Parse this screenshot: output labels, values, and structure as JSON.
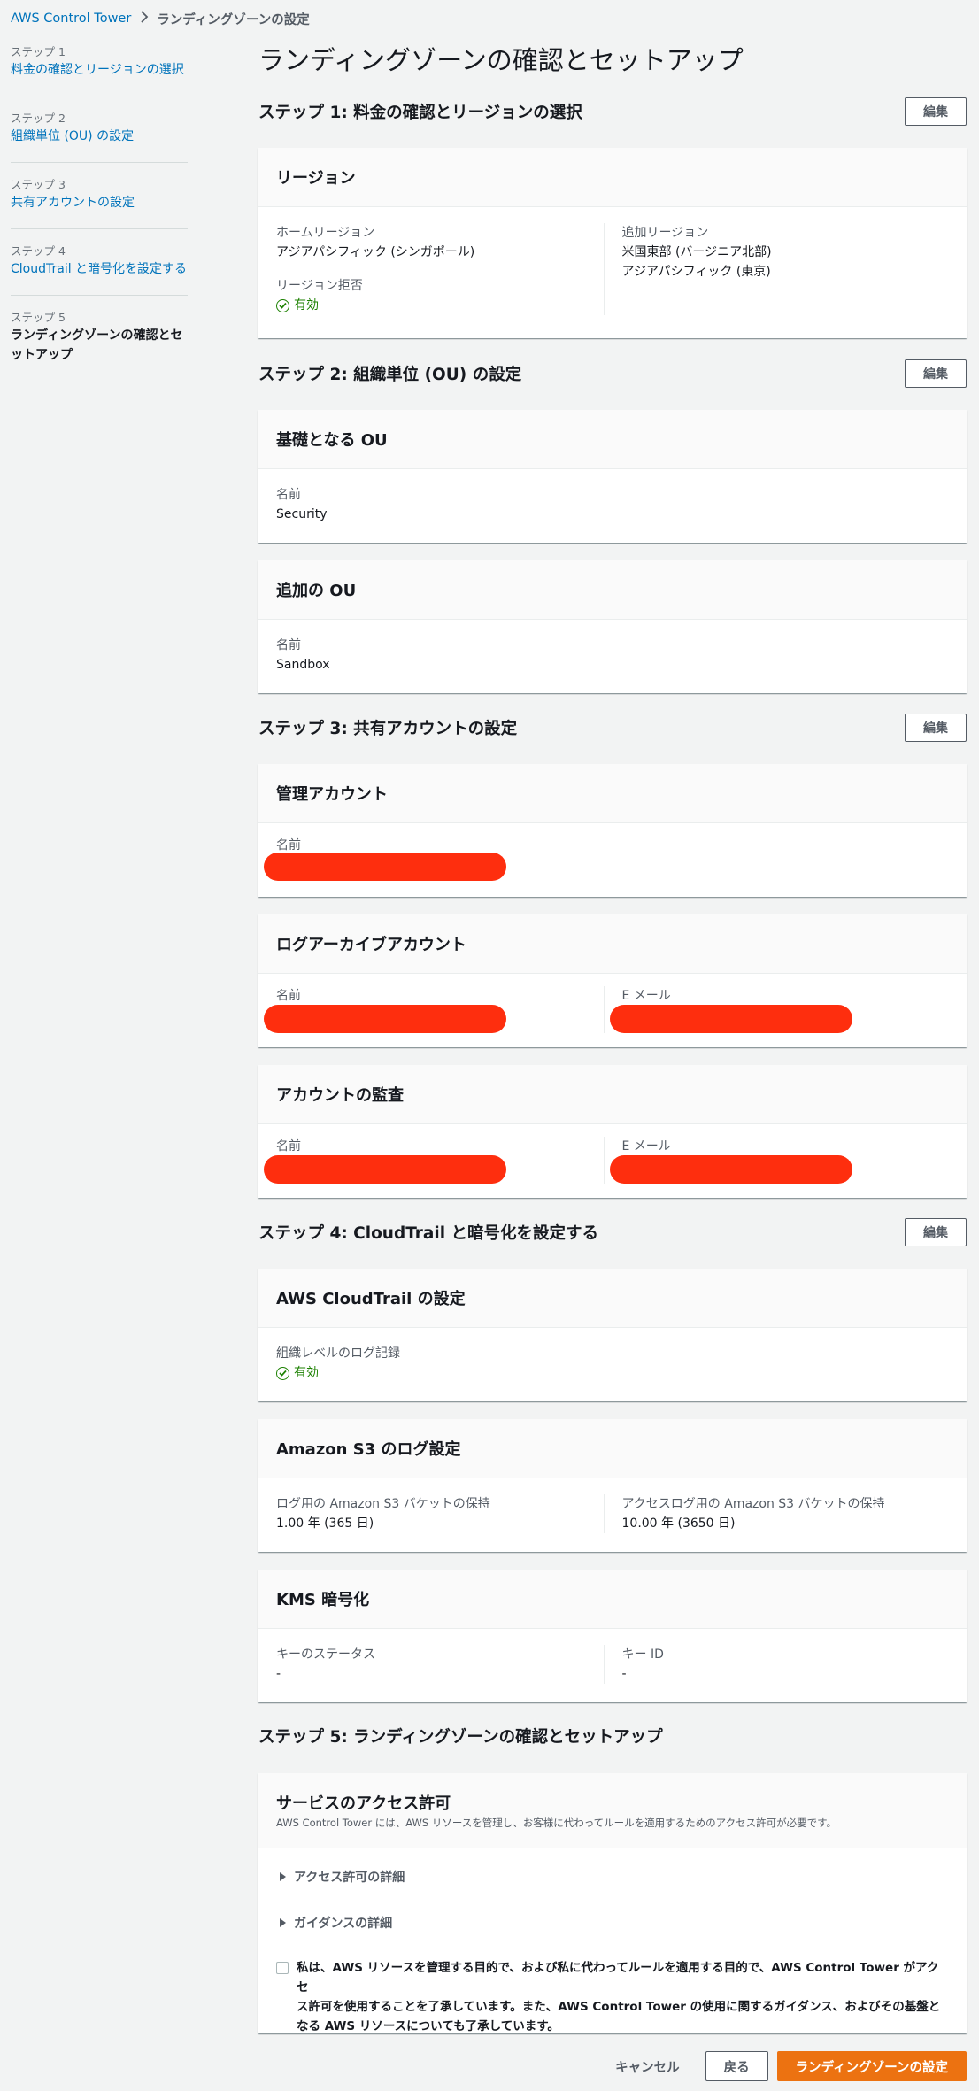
{
  "breadcrumb": {
    "root": "AWS Control Tower",
    "current": "ランディングゾーンの設定"
  },
  "sidenav": [
    {
      "num": "ステップ 1",
      "label": "料金の確認とリージョンの選択"
    },
    {
      "num": "ステップ 2",
      "label": "組織単位 (OU) の設定"
    },
    {
      "num": "ステップ 3",
      "label": "共有アカウントの設定"
    },
    {
      "num": "ステップ 4",
      "label": "CloudTrail と暗号化を設定する"
    },
    {
      "num": "ステップ 5",
      "label_line1": "ランディングゾーンの確認とセ",
      "label_line2": "ットアップ"
    }
  ],
  "page_title": "ランディングゾーンの確認とセットアップ",
  "edit_label": "編集",
  "step1": {
    "title": "ステップ 1: 料金の確認とリージョンの選択",
    "region_panel": {
      "heading": "リージョン",
      "home_region_label": "ホームリージョン",
      "home_region_value": "アジアパシフィック (シンガポール)",
      "deny_label": "リージョン拒否",
      "deny_value": "有効",
      "additional_label": "追加リージョン",
      "additional_values": [
        "米国東部 (バージニア北部)",
        "アジアパシフィック (東京)"
      ]
    }
  },
  "step2": {
    "title": "ステップ 2: 組織単位 (OU) の設定",
    "foundational": {
      "heading": "基礎となる OU",
      "name_label": "名前",
      "name_value": "Security"
    },
    "additional": {
      "heading": "追加の OU",
      "name_label": "名前",
      "name_value": "Sandbox"
    }
  },
  "step3": {
    "title": "ステップ 3: 共有アカウントの設定",
    "management": {
      "heading": "管理アカウント",
      "name_label": "名前"
    },
    "log_archive": {
      "heading": "ログアーカイブアカウント",
      "name_label": "名前",
      "email_label": "E メール"
    },
    "audit": {
      "heading": "アカウントの監査",
      "name_label": "名前",
      "email_label": "E メール"
    }
  },
  "step4": {
    "title": "ステップ 4: CloudTrail と暗号化を設定する",
    "cloudtrail": {
      "heading": "AWS CloudTrail の設定",
      "org_logging_label": "組織レベルのログ記録",
      "org_logging_value": "有効"
    },
    "s3": {
      "heading": "Amazon S3 のログ設定",
      "log_retention_label": "ログ用の Amazon S3 バケットの保持",
      "log_retention_value": "1.00 年 (365 日)",
      "access_retention_label": "アクセスログ用の Amazon S3 バケットの保持",
      "access_retention_value": "10.00 年 (3650 日)"
    },
    "kms": {
      "heading": "KMS 暗号化",
      "key_status_label": "キーのステータス",
      "key_status_value": "-",
      "key_id_label": "キー ID",
      "key_id_value": "-"
    }
  },
  "step5": {
    "title": "ステップ 5: ランディングゾーンの確認とセットアップ",
    "permissions": {
      "heading": "サービスのアクセス許可",
      "subtitle": "AWS Control Tower には、AWS リソースを管理し、お客様に代わってルールを適用するためのアクセス許可が必要です。",
      "expander1": "アクセス許可の詳細",
      "expander2": "ガイダンスの詳細",
      "ack_line1": "私は、AWS リソースを管理する目的で、および私に代わってルールを適用する目的で、AWS Control Tower がアクセ",
      "ack_line2": "ス許可を使用することを了承しています。また、AWS Control Tower の使用に関するガイダンス、およびその基盤と",
      "ack_line3": "なる AWS リソースについても了承しています。"
    }
  },
  "footer": {
    "cancel": "キャンセル",
    "back": "戻る",
    "submit": "ランディングゾーンの設定"
  },
  "colors": {
    "link": "#0073bb",
    "status_ok": "#1d8102",
    "primary": "#ec7211",
    "redaction": "#fe2e0e"
  }
}
